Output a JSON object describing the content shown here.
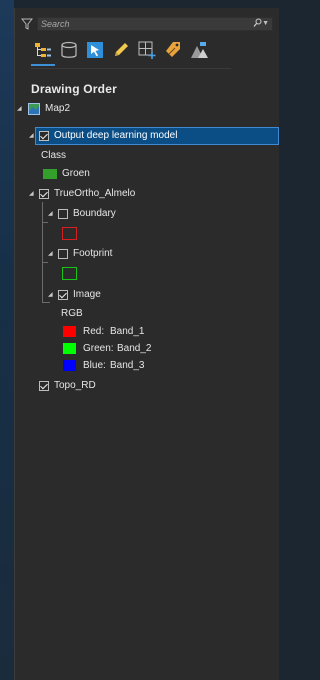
{
  "search": {
    "placeholder": "Search"
  },
  "toolbar": {
    "items": [
      "list-by-drawing-order",
      "list-by-data-source",
      "list-by-selection",
      "list-by-editing",
      "list-by-snapping",
      "list-by-labeling",
      "list-by-perspective-imagery"
    ]
  },
  "panel": {
    "heading": "Drawing Order"
  },
  "tree": {
    "map": {
      "label": "Map2"
    },
    "output_layer": {
      "label": "Output deep learning model",
      "checked": true,
      "class_header": "Class",
      "class_label": "Groen",
      "class_color": "#33a02c"
    },
    "ortho": {
      "label": "TrueOrtho_Almelo",
      "checked": true
    },
    "boundary": {
      "label": "Boundary",
      "checked": false,
      "color": "#d42020"
    },
    "footprint": {
      "label": "Footprint",
      "checked": false,
      "color": "#19c419"
    },
    "image": {
      "label": "Image",
      "checked": true,
      "rgb_header": "RGB",
      "bands": [
        {
          "label": "Red:",
          "value": "Band_1",
          "color": "#ff0000"
        },
        {
          "label": "Green:",
          "value": "Band_2",
          "color": "#00ff00"
        },
        {
          "label": "Blue:",
          "value": "Band_3",
          "color": "#0000ff"
        }
      ]
    },
    "topo": {
      "label": "Topo_RD",
      "checked": true
    }
  }
}
